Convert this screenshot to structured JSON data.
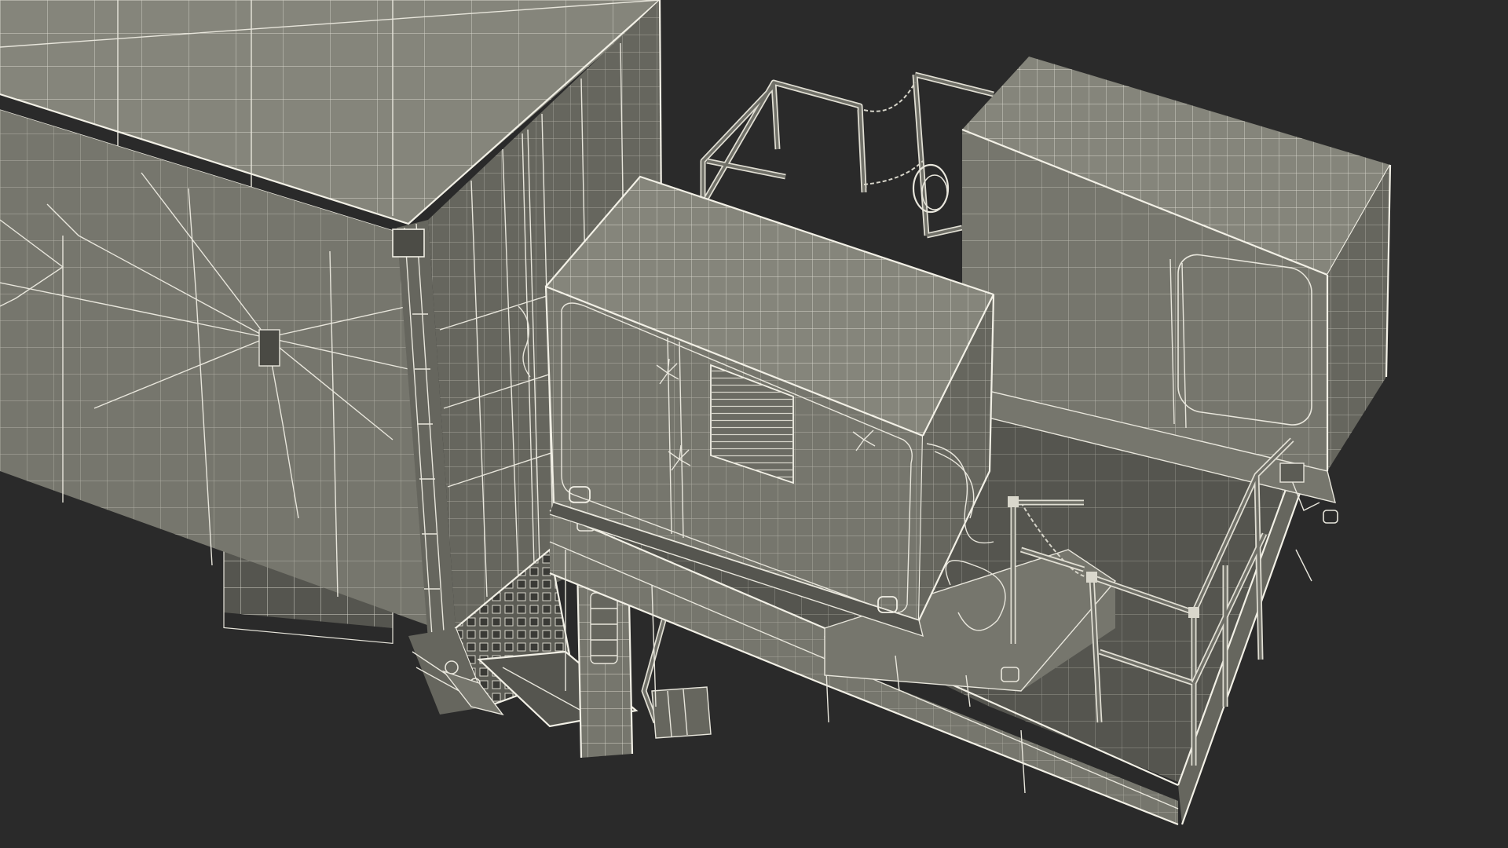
{
  "scene": {
    "background": "#2a2a2a",
    "surface_color": "#7a7a71",
    "wire_color": "#e8e6dc"
  }
}
